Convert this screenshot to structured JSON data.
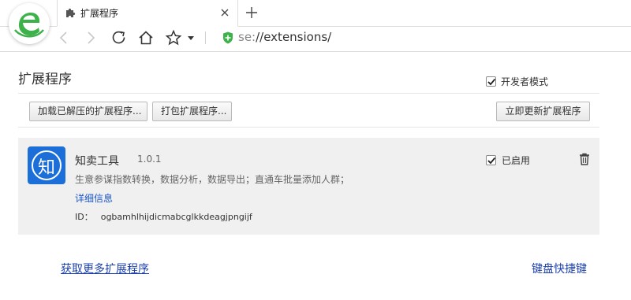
{
  "colors": {
    "accent_green": "#3db14a",
    "link_blue": "#1a3fae",
    "ext_icon_blue": "#1c6fd9",
    "card_bg": "#f0f0f0"
  },
  "browser": {
    "logo_icon": "browser-e-logo-icon",
    "tab": {
      "title": "扩展程序",
      "icon": "puzzle-icon"
    },
    "address_bar": {
      "scheme": "se:",
      "rest": "//extensions/"
    }
  },
  "page": {
    "title": "扩展程序",
    "developer_mode": {
      "label": "开发者模式",
      "checked": true
    },
    "toolbar": {
      "load_unpacked": "加载已解压的扩展程序...",
      "pack": "打包扩展程序...",
      "update_now": "立即更新扩展程序"
    }
  },
  "extensions": [
    {
      "icon_glyph": "知",
      "name": "知卖工具",
      "version": "1.0.1",
      "description": "生意参谋指数转换，数据分析，数据导出；直通车批量添加人群；",
      "details_link": "详细信息",
      "id_label": "ID：",
      "id": "ogbamhlhijdicmabcglkkdeagjpngijf",
      "enabled_label": "已启用",
      "enabled": true
    }
  ],
  "footer": {
    "more_extensions": "获取更多扩展程序",
    "keyboard_shortcuts": "键盘快捷键"
  }
}
